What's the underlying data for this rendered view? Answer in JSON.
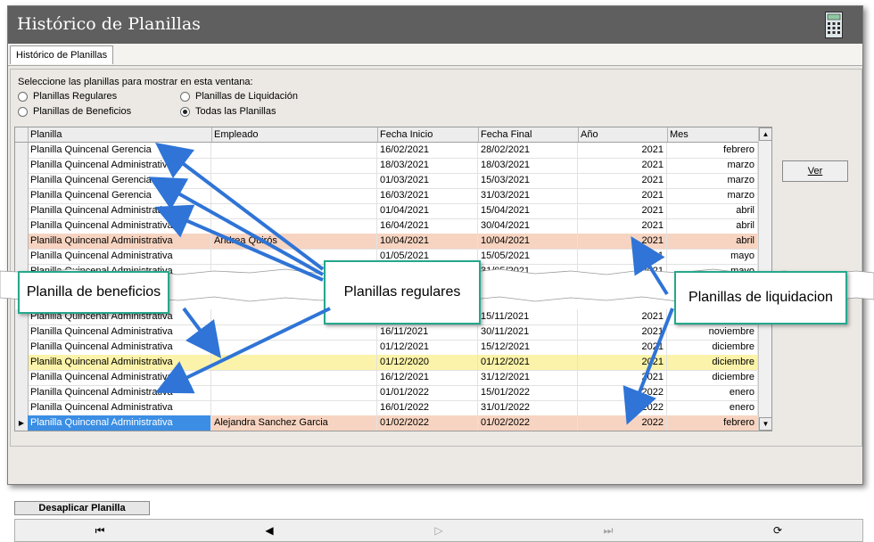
{
  "window": {
    "title": "Histórico de Planillas"
  },
  "tabs": [
    {
      "label": "Histórico de Planillas"
    }
  ],
  "filter": {
    "prompt": "Seleccione las planillas para mostrar en esta ventana:",
    "options": [
      {
        "label": "Planillas Regulares",
        "selected": false
      },
      {
        "label": "Planillas de Beneficios",
        "selected": false
      },
      {
        "label": "Planillas de Liquidación",
        "selected": false
      },
      {
        "label": "Todas las Planillas",
        "selected": true
      }
    ]
  },
  "grid": {
    "columns": [
      "Planilla",
      "Empleado",
      "Fecha Inicio",
      "Fecha Final",
      "Año",
      "Mes"
    ],
    "rows_top": [
      [
        "Planilla Quincenal Gerencia",
        "",
        "16/02/2021",
        "28/02/2021",
        "2021",
        "febrero"
      ],
      [
        "Planilla Quincenal Administrativa",
        "",
        "18/03/2021",
        "18/03/2021",
        "2021",
        "marzo"
      ],
      [
        "Planilla Quincenal Gerencia",
        "",
        "01/03/2021",
        "15/03/2021",
        "2021",
        "marzo"
      ],
      [
        "Planilla Quincenal Gerencia",
        "",
        "16/03/2021",
        "31/03/2021",
        "2021",
        "marzo"
      ],
      [
        "Planilla Quincenal Administrativa",
        "",
        "01/04/2021",
        "15/04/2021",
        "2021",
        "abril"
      ],
      [
        "Planilla Quincenal Administrativa",
        "",
        "16/04/2021",
        "30/04/2021",
        "2021",
        "abril"
      ],
      [
        "Planilla Quincenal Administrativa",
        "Andrea Quirós",
        "10/04/2021",
        "10/04/2021",
        "2021",
        "abril"
      ],
      [
        "Planilla Quincenal Administrativa",
        "",
        "01/05/2021",
        "15/05/2021",
        "2021",
        "mayo"
      ],
      [
        "Planilla Quincenal Administrativa",
        "",
        "16/05/2021",
        "31/05/2021",
        "2021",
        "mayo"
      ]
    ],
    "rows_bottom": [
      [
        "Planilla Quincenal Administrativa",
        "",
        "01/11/2021",
        "15/11/2021",
        "2021",
        "noviembre"
      ],
      [
        "Planilla Quincenal Administrativa",
        "",
        "16/11/2021",
        "30/11/2021",
        "2021",
        "noviembre"
      ],
      [
        "Planilla Quincenal Administrativa",
        "",
        "01/12/2021",
        "15/12/2021",
        "2021",
        "diciembre"
      ],
      [
        "Planilla Quincenal Administrativa",
        "",
        "01/12/2020",
        "01/12/2021",
        "2021",
        "diciembre"
      ],
      [
        "Planilla Quincenal Administrativa",
        "",
        "16/12/2021",
        "31/12/2021",
        "2021",
        "diciembre"
      ],
      [
        "Planilla Quincenal Administrativa",
        "",
        "01/01/2022",
        "15/01/2022",
        "2022",
        "enero"
      ],
      [
        "Planilla Quincenal Administrativa",
        "",
        "16/01/2022",
        "31/01/2022",
        "2022",
        "enero"
      ],
      [
        "Planilla Quincenal Administrativa",
        "Alejandra Sanchez Garcia",
        "01/02/2022",
        "01/02/2022",
        "2022",
        "febrero"
      ]
    ],
    "row_types_top": [
      "regular",
      "regular",
      "regular",
      "regular",
      "regular",
      "regular",
      "liquidacion",
      "regular",
      "regular"
    ],
    "row_types_bottom": [
      "regular",
      "regular",
      "regular",
      "beneficio",
      "regular",
      "regular",
      "regular",
      "liquidacion-selected"
    ],
    "colors": {
      "liquidacion": "#f7d4c1",
      "beneficio": "#fbf3a9",
      "selected": "#3b8ee3"
    }
  },
  "buttons": {
    "ver": "Ver",
    "desaplicar": "Desaplicar Planilla"
  },
  "nav": {
    "first": "first-icon",
    "prev": "prev-icon",
    "next": "next-icon",
    "last": "last-icon",
    "refresh": "refresh-icon"
  },
  "callouts": {
    "beneficios": "Planilla de beneficios",
    "regulares": "Planillas regulares",
    "liquidacion": "Planillas de liquidacion"
  },
  "icons": {
    "calculator": "calculator-icon",
    "row_pointer": "row-pointer-icon"
  }
}
